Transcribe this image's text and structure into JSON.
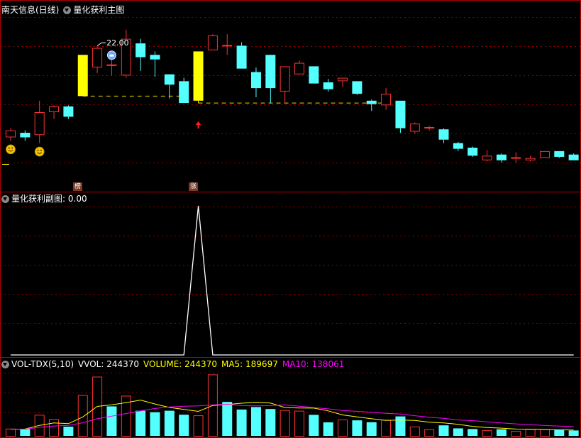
{
  "main_panel": {
    "stock_label": "南天信息(日线)",
    "indicator_label": "量化获利主图",
    "max_price_label": "22.00",
    "badge_1": "榜",
    "badge_2": "涨"
  },
  "sub_panel": {
    "title": "量化获利副图",
    "value": ": 0.00"
  },
  "vol_panel": {
    "title": "VOL-TDX(5,10)",
    "vvol": "VVOL: 244370",
    "volume": "VOLUME: 244370",
    "ma5": "MA5: 189697",
    "ma10": "MA10: 138061"
  },
  "colors": {
    "up": "#ff3232",
    "down": "#54ffff",
    "limit_up": "#ffff00",
    "ma5": "#ffff00",
    "ma10": "#ff00ff",
    "grid": "#8b0000",
    "border": "#b40000"
  },
  "chart_data": [
    {
      "type": "candlestick",
      "title": "量化获利主图",
      "annotation_max": 22.0,
      "candles": [
        {
          "o": 14.0,
          "c": 14.6,
          "h": 14.8,
          "l": 13.7,
          "dir": "up"
        },
        {
          "o": 14.4,
          "c": 14.0,
          "h": 14.6,
          "l": 13.7,
          "dir": "down"
        },
        {
          "o": 14.2,
          "c": 16.2,
          "h": 17.2,
          "l": 13.5,
          "dir": "up"
        },
        {
          "o": 16.2,
          "c": 16.7,
          "h": 16.8,
          "l": 15.6,
          "dir": "up"
        },
        {
          "o": 16.7,
          "c": 15.8,
          "h": 16.8,
          "l": 15.6,
          "dir": "down"
        },
        {
          "o": 17.6,
          "c": 21.2,
          "h": 21.2,
          "l": 17.6,
          "dir": "limit"
        },
        {
          "o": 20.1,
          "c": 21.8,
          "h": 22.0,
          "l": 19.6,
          "dir": "up"
        },
        {
          "o": 20.3,
          "c": 20.3,
          "h": 20.8,
          "l": 19.4,
          "dir": "doji"
        },
        {
          "o": 19.4,
          "c": 22.6,
          "h": 23.4,
          "l": 19.2,
          "dir": "up"
        },
        {
          "o": 22.2,
          "c": 21.0,
          "h": 22.6,
          "l": 19.8,
          "dir": "down"
        },
        {
          "o": 21.2,
          "c": 20.8,
          "h": 21.5,
          "l": 19.3,
          "dir": "down"
        },
        {
          "o": 19.5,
          "c": 18.6,
          "h": 19.5,
          "l": 17.4,
          "dir": "down"
        },
        {
          "o": 18.9,
          "c": 17.0,
          "h": 19.2,
          "l": 17.0,
          "dir": "down"
        },
        {
          "o": 17.2,
          "c": 21.5,
          "h": 21.5,
          "l": 17.0,
          "dir": "limit"
        },
        {
          "o": 21.6,
          "c": 22.9,
          "h": 23.0,
          "l": 21.6,
          "dir": "up"
        },
        {
          "o": 22.0,
          "c": 22.0,
          "h": 23.0,
          "l": 21.2,
          "dir": "doji"
        },
        {
          "o": 22.0,
          "c": 20.0,
          "h": 22.3,
          "l": 20.0,
          "dir": "down"
        },
        {
          "o": 19.7,
          "c": 18.3,
          "h": 20.1,
          "l": 17.5,
          "dir": "down"
        },
        {
          "o": 21.2,
          "c": 18.3,
          "h": 21.2,
          "l": 17.0,
          "dir": "down"
        },
        {
          "o": 18.0,
          "c": 20.2,
          "h": 20.2,
          "l": 17.0,
          "dir": "up"
        },
        {
          "o": 19.5,
          "c": 20.5,
          "h": 20.7,
          "l": 19.5,
          "dir": "up"
        },
        {
          "o": 20.2,
          "c": 18.7,
          "h": 20.2,
          "l": 18.7,
          "dir": "down"
        },
        {
          "o": 18.8,
          "c": 18.2,
          "h": 19.1,
          "l": 18.0,
          "dir": "down"
        },
        {
          "o": 18.9,
          "c": 19.2,
          "h": 19.2,
          "l": 18.4,
          "dir": "up"
        },
        {
          "o": 18.9,
          "c": 17.8,
          "h": 18.9,
          "l": 17.7,
          "dir": "down"
        },
        {
          "o": 17.2,
          "c": 16.9,
          "h": 17.3,
          "l": 16.3,
          "dir": "down"
        },
        {
          "o": 16.8,
          "c": 17.8,
          "h": 18.3,
          "l": 16.4,
          "dir": "up"
        },
        {
          "o": 17.2,
          "c": 14.8,
          "h": 17.2,
          "l": 14.4,
          "dir": "down"
        },
        {
          "o": 14.5,
          "c": 15.2,
          "h": 15.3,
          "l": 14.3,
          "dir": "up"
        },
        {
          "o": 14.8,
          "c": 14.9,
          "h": 15.0,
          "l": 14.6,
          "dir": "up"
        },
        {
          "o": 14.7,
          "c": 13.8,
          "h": 14.8,
          "l": 13.5,
          "dir": "down"
        },
        {
          "o": 13.5,
          "c": 13.0,
          "h": 13.6,
          "l": 12.8,
          "dir": "down"
        },
        {
          "o": 13.1,
          "c": 12.4,
          "h": 13.2,
          "l": 12.3,
          "dir": "down"
        },
        {
          "o": 12.0,
          "c": 12.4,
          "h": 12.9,
          "l": 11.9,
          "dir": "up"
        },
        {
          "o": 12.5,
          "c": 12.0,
          "h": 12.6,
          "l": 11.8,
          "dir": "down"
        },
        {
          "o": 12.2,
          "c": 12.2,
          "h": 12.7,
          "l": 11.8,
          "dir": "doji"
        },
        {
          "o": 12.0,
          "c": 12.2,
          "h": 12.4,
          "l": 11.9,
          "dir": "up"
        },
        {
          "o": 12.2,
          "c": 12.8,
          "h": 12.8,
          "l": 12.2,
          "dir": "up"
        },
        {
          "o": 12.8,
          "c": 12.3,
          "h": 12.8,
          "l": 12.2,
          "dir": "down"
        },
        {
          "o": 12.5,
          "c": 12.0,
          "h": 12.6,
          "l": 12.0,
          "dir": "down"
        }
      ],
      "support_levels": [
        {
          "from": 5,
          "to": 12,
          "value": 17.6
        },
        {
          "from": 13,
          "to": 26,
          "value": 17.0
        }
      ],
      "smiley_markers": [
        0,
        2
      ],
      "ghost_marker": 7,
      "arrow_marker": 13
    },
    {
      "type": "line",
      "title": "量化获利副图",
      "values": [
        0,
        0,
        0,
        0,
        0,
        0,
        0,
        0,
        0,
        0,
        0,
        0,
        0,
        1,
        0,
        0,
        0,
        0,
        0,
        0,
        0,
        0,
        0,
        0,
        0,
        0,
        0,
        0,
        0,
        0,
        0,
        0,
        0,
        0,
        0,
        0,
        0,
        0,
        0,
        0
      ],
      "ylim": [
        0,
        1
      ]
    },
    {
      "type": "bar",
      "title": "VOL-TDX(5,10)",
      "values": [
        55000,
        52000,
        160000,
        128000,
        70000,
        310000,
        450000,
        224000,
        305000,
        191000,
        180000,
        191000,
        161000,
        156000,
        467000,
        258000,
        200000,
        219000,
        204000,
        196000,
        191000,
        160000,
        103000,
        124000,
        118000,
        104000,
        122000,
        148000,
        71000,
        49000,
        80000,
        57000,
        52000,
        44000,
        50000,
        37000,
        52000,
        50000,
        48000,
        41000
      ],
      "ma5": [
        50000,
        52000,
        80000,
        98000,
        93000,
        144000,
        224000,
        236000,
        253000,
        272000,
        242000,
        216000,
        201000,
        186000,
        231000,
        238000,
        248000,
        255000,
        249000,
        215000,
        212000,
        211000,
        190000,
        159000,
        144000,
        130000,
        117000,
        121000,
        117000,
        104000,
        98000,
        88000,
        72000,
        63000,
        59000,
        52000,
        51000,
        48000,
        46000,
        45000
      ],
      "ma10": [
        50000,
        50000,
        65000,
        75000,
        80000,
        100000,
        130000,
        150000,
        170000,
        190000,
        208000,
        220000,
        225000,
        228000,
        235000,
        240000,
        230000,
        228000,
        230000,
        235000,
        225000,
        215000,
        205000,
        193000,
        186000,
        179000,
        171000,
        166000,
        153000,
        142000,
        133000,
        121000,
        116000,
        106000,
        98000,
        91000,
        85000,
        79000,
        74000,
        70000
      ],
      "directions": [
        "up",
        "down",
        "up",
        "up",
        "down",
        "up",
        "up",
        "down",
        "up",
        "down",
        "down",
        "down",
        "down",
        "up",
        "up",
        "down",
        "down",
        "down",
        "down",
        "up",
        "up",
        "down",
        "down",
        "up",
        "down",
        "down",
        "up",
        "down",
        "up",
        "up",
        "down",
        "down",
        "down",
        "up",
        "down",
        "up",
        "up",
        "up",
        "down",
        "down"
      ]
    }
  ]
}
